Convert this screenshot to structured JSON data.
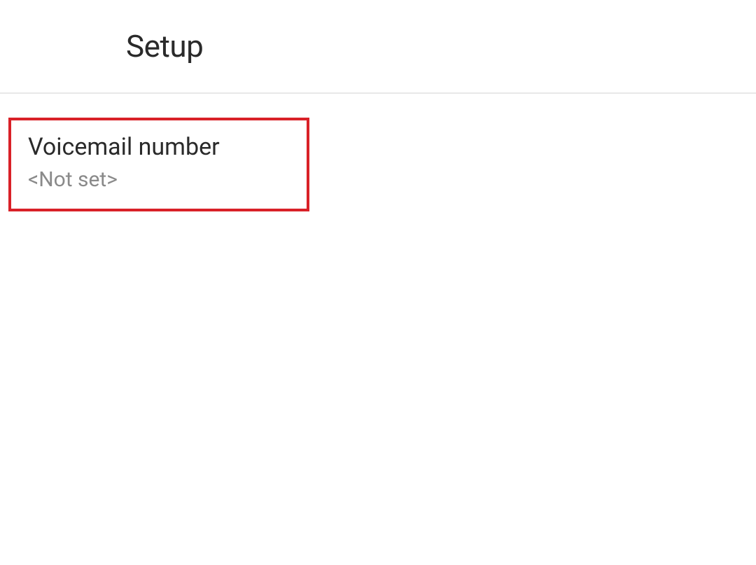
{
  "header": {
    "title": "Setup"
  },
  "settings": {
    "voicemail": {
      "label": "Voicemail number",
      "value": "<Not set>"
    }
  }
}
